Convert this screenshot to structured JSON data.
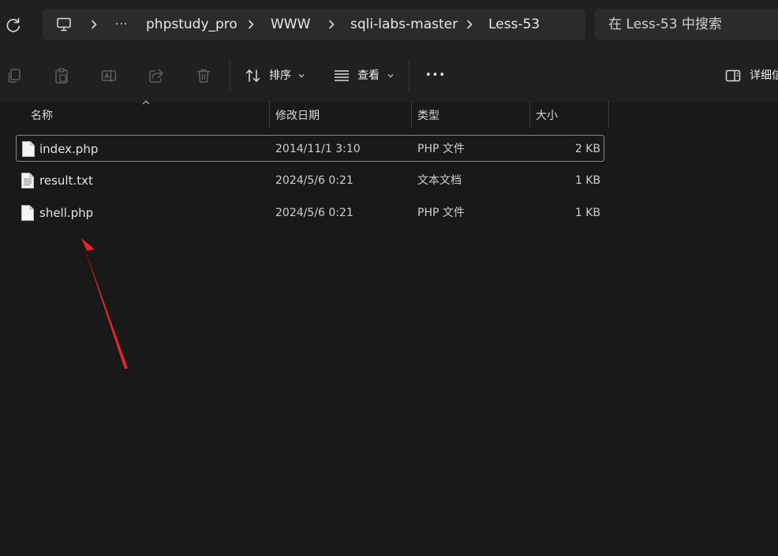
{
  "address_bar": {
    "more_label": "···",
    "breadcrumbs": [
      "phpstudy_pro",
      "WWW",
      "sqli-labs-master",
      "Less-53"
    ]
  },
  "search": {
    "placeholder": "在 Less-53 中搜索"
  },
  "toolbar": {
    "sort_label": "排序",
    "view_label": "查看",
    "more_label": "•••",
    "details_label": "详细信息"
  },
  "columns": {
    "name": "名称",
    "modified": "修改日期",
    "type": "类型",
    "size": "大小"
  },
  "files": [
    {
      "name": "index.php",
      "modified": "2014/11/1 3:10",
      "type": "PHP 文件",
      "size": "2 KB"
    },
    {
      "name": "result.txt",
      "modified": "2024/5/6 0:21",
      "type": "文本文档",
      "size": "1 KB"
    },
    {
      "name": "shell.php",
      "modified": "2024/5/6 0:21",
      "type": "PHP 文件",
      "size": "1 KB"
    }
  ],
  "annotation_color": "#e3262a"
}
